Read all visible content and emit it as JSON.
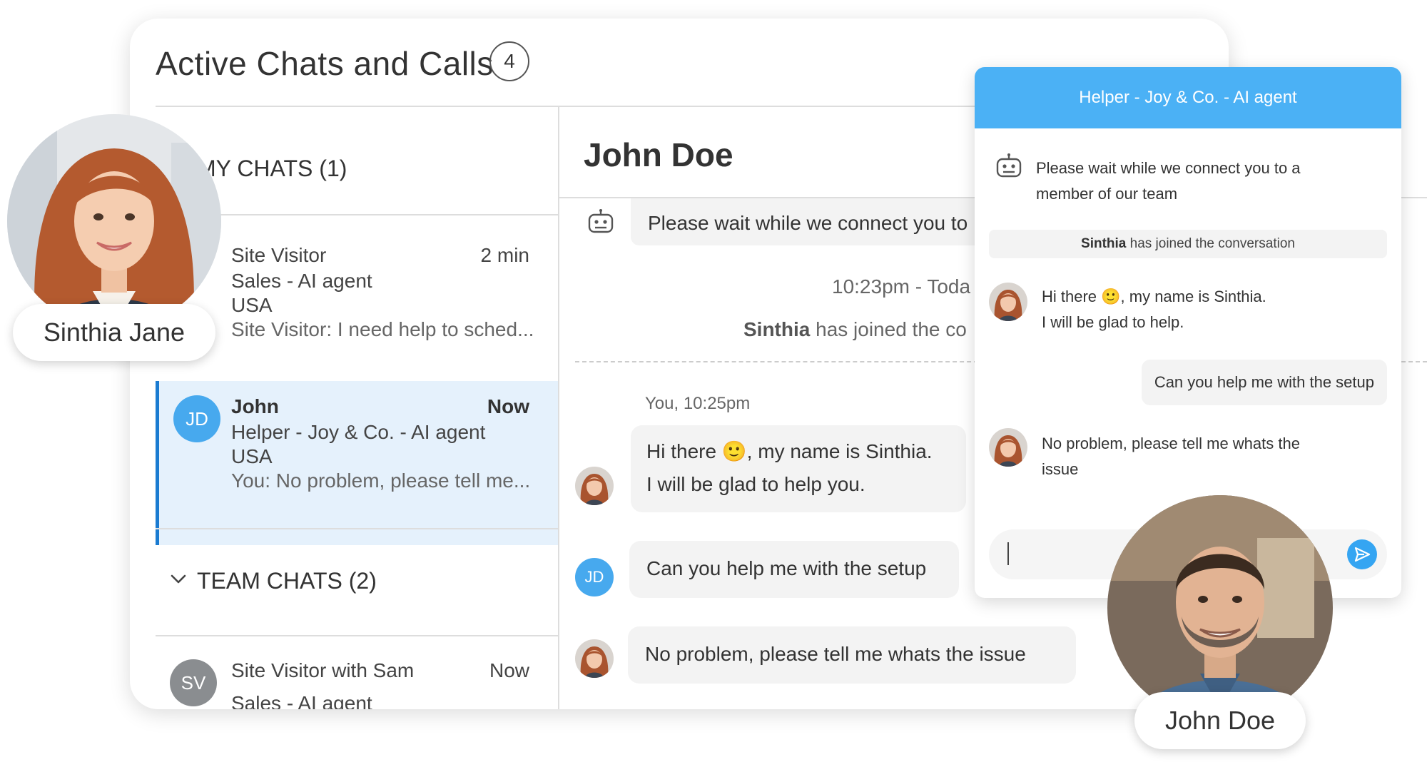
{
  "main": {
    "title": "Active Chats and Calls",
    "count": "4"
  },
  "sections": {
    "my_chats": "MY CHATS  (1)",
    "team_chats": "TEAM CHATS (2)"
  },
  "chats": [
    {
      "name": "Site Visitor",
      "time": "2 min",
      "group": "Sales - AI agent",
      "country": "USA",
      "preview": "Site Visitor: I need help to sched..."
    },
    {
      "initials": "JD",
      "name": "John",
      "time": "Now",
      "group": "Helper - Joy & Co. - AI agent",
      "country": "USA",
      "preview": "You: No problem, please tell me..."
    },
    {
      "initials": "SV",
      "name": "Site Visitor  with Sam",
      "time": "Now",
      "group": "Sales - AI agent"
    }
  ],
  "conversation": {
    "name": "John Doe",
    "bot_message": "Please wait while we connect you to",
    "time_divider": "10:23pm - Toda",
    "joined_name": "Sinthia",
    "joined_text": " has joined the co",
    "you_label": "You, 10:25pm",
    "msg1_line1": "Hi there 🙂, my name is Sinthia.",
    "msg1_line2": "I will be glad to help you.",
    "msg2": "Can you help me with the setup",
    "msg2_initials": "JD",
    "msg3": "No problem, please tell me whats the issue"
  },
  "widget": {
    "header": "Helper - Joy & Co. - AI agent",
    "bot_line1": "Please wait while we connect you to a",
    "bot_line2": "member of our team",
    "joined_name": "Sinthia",
    "joined_text": " has joined the conversation",
    "msg1_line1": "Hi there 🙂, my name is Sinthia.",
    "msg1_line2": "I will be glad to help.",
    "msg2": "Can you help me with the setup",
    "msg3_line1": "No problem, please tell me whats the",
    "msg3_line2": "issue"
  },
  "people": {
    "agent": "Sinthia Jane",
    "visitor": "John Doe"
  },
  "colors": {
    "accent": "#4bb1f5",
    "selected_bg": "#e5f1fc",
    "selected_border": "#1a7bd1",
    "avatar_jd": "#47a9ee",
    "avatar_sv": "#8a8d90"
  }
}
